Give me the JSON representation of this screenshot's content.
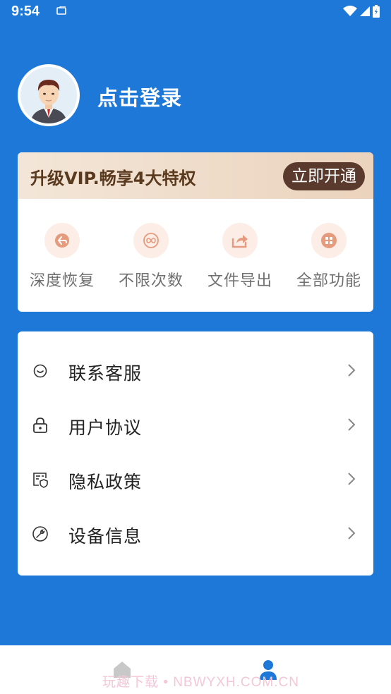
{
  "status_bar": {
    "time": "9:54"
  },
  "profile": {
    "login_text": "点击登录"
  },
  "vip": {
    "title": "升级VIP.畅享4大特权",
    "button": "立即开通",
    "features": [
      {
        "label": "深度恢复",
        "icon": "restore-icon"
      },
      {
        "label": "不限次数",
        "icon": "infinity-icon"
      },
      {
        "label": "文件导出",
        "icon": "share-icon"
      },
      {
        "label": "全部功能",
        "icon": "grid-icon"
      }
    ]
  },
  "menu": {
    "items": [
      {
        "label": "联系客服",
        "icon": "smile-icon"
      },
      {
        "label": "用户协议",
        "icon": "lock-icon"
      },
      {
        "label": "隐私政策",
        "icon": "privacy-icon"
      },
      {
        "label": "设备信息",
        "icon": "wrench-icon"
      }
    ]
  },
  "watermark": "玩趣下载 • NBWYXH.COM.CN",
  "colors": {
    "primary": "#1E78D8",
    "vip_brown": "#5A3A2C",
    "feature_bg": "#FCEDE6",
    "feature_icon": "#E59B7D"
  }
}
